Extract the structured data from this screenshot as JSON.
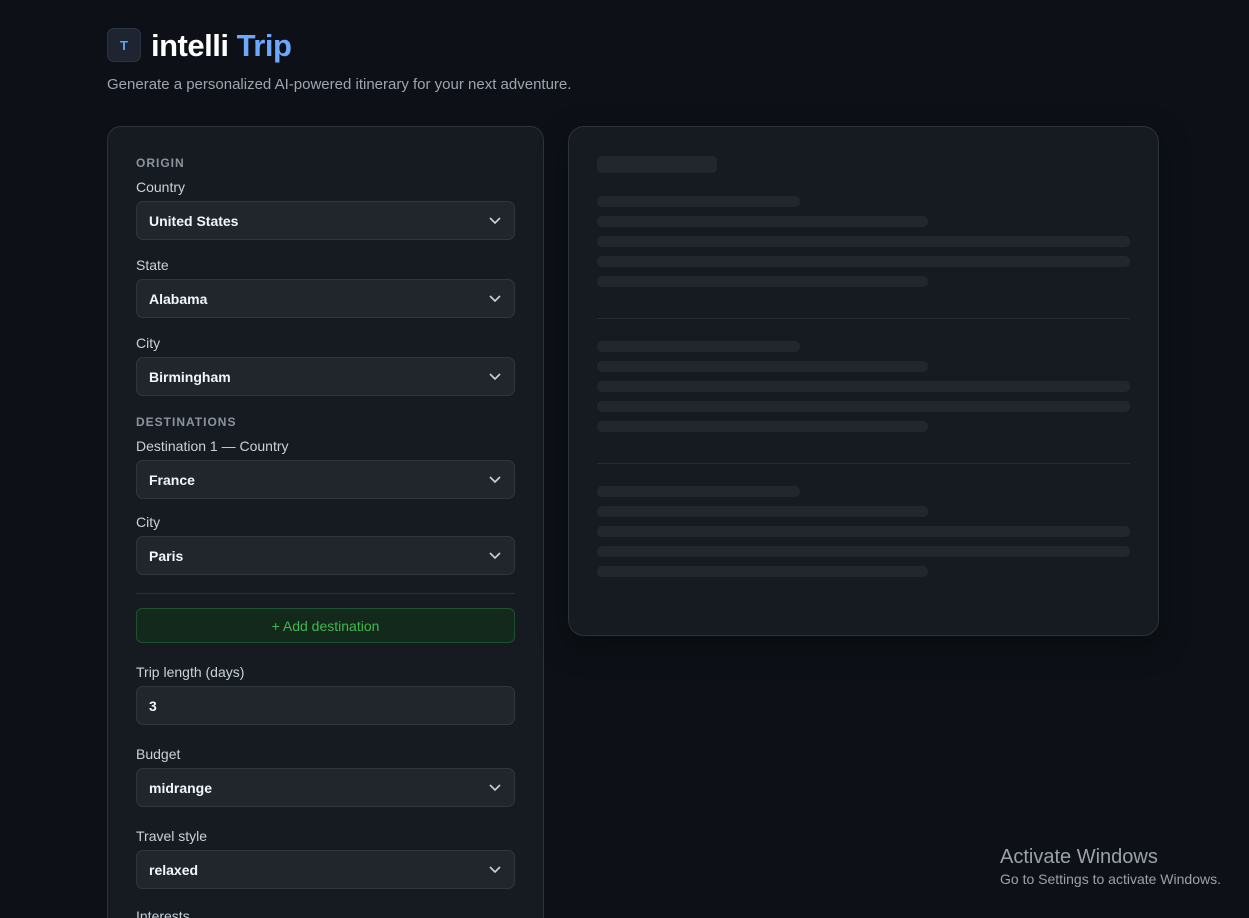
{
  "brand": {
    "logo_letter": "T",
    "name_part1": "intelli",
    "name_part2": "Trip",
    "tagline": "Generate a personalized AI-powered itinerary for your next adventure."
  },
  "form": {
    "origin_title": "ORIGIN",
    "country_label": "Country",
    "country_value": "United States",
    "state_label": "State",
    "state_value": "Alabama",
    "city_label": "City",
    "city_value": "Birmingham",
    "destinations_title": "DESTINATIONS",
    "dest1_country_label": "Destination 1 — Country",
    "dest1_country_value": "France",
    "dest1_city_label": "City",
    "dest1_city_value": "Paris",
    "add_destination_label": "+ Add destination",
    "trip_length_label": "Trip length (days)",
    "trip_length_value": "3",
    "budget_label": "Budget",
    "budget_value": "midrange",
    "travel_style_label": "Travel style",
    "travel_style_value": "relaxed",
    "interests_label": "Interests"
  },
  "watermark": {
    "title": "Activate Windows",
    "subtitle": "Go to Settings to activate Windows."
  },
  "colors": {
    "background": "#0d1117",
    "panel": "#161b22",
    "accent_blue": "#6ea8fe",
    "accent_green": "#3fb950"
  }
}
